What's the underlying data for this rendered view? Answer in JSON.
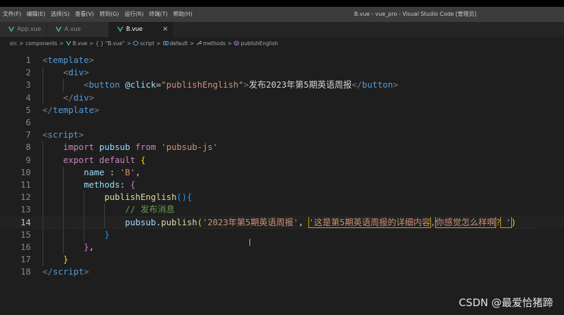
{
  "titlebar": {
    "menu": [
      "文件(F)",
      "编辑(E)",
      "选择(S)",
      "查看(V)",
      "转到(G)",
      "运行(R)",
      "终端(T)",
      "帮助(H)"
    ],
    "window_title": "B.vue - vue_pro - Visual Studio Code [管理员]"
  },
  "tabs": [
    {
      "label": "App.vue",
      "active": false
    },
    {
      "label": "A.vue",
      "active": false
    },
    {
      "label": "B.vue",
      "active": true,
      "close": "×"
    }
  ],
  "colors": {
    "vue_icon": "#42b883",
    "accent": "#007acc"
  },
  "breadcrumb": {
    "items": [
      {
        "label": "src",
        "icon": ""
      },
      {
        "label": "components",
        "icon": ""
      },
      {
        "label": "B.vue",
        "icon": "vue-icon"
      },
      {
        "label": "{ } \"B.vue\"",
        "icon": ""
      },
      {
        "label": "script",
        "icon": "script-icon"
      },
      {
        "label": "default",
        "icon": "variable-icon"
      },
      {
        "label": "methods",
        "icon": "wrench-icon"
      },
      {
        "label": "publishEnglish",
        "icon": "method-icon"
      }
    ],
    "separator": ">"
  },
  "editor": {
    "line_numbers": [
      "1",
      "2",
      "3",
      "4",
      "5",
      "6",
      "7",
      "8",
      "9",
      "10",
      "11",
      "12",
      "13",
      "14",
      "15",
      "16",
      "17",
      "18"
    ],
    "current_line": 14,
    "lines": [
      [
        [
          "t-punc",
          "<"
        ],
        [
          "t-tag",
          "template"
        ],
        [
          "t-punc",
          ">"
        ]
      ],
      [
        [
          "t-plain",
          "    "
        ],
        [
          "t-punc",
          "<"
        ],
        [
          "t-tag",
          "div"
        ],
        [
          "t-punc",
          ">"
        ]
      ],
      [
        [
          "t-plain",
          "        "
        ],
        [
          "t-punc",
          "<"
        ],
        [
          "t-tag",
          "button"
        ],
        [
          "t-plain",
          " "
        ],
        [
          "t-attr",
          "@click"
        ],
        [
          "t-plain",
          "="
        ],
        [
          "t-str",
          "\"publishEnglish\""
        ],
        [
          "t-punc",
          ">"
        ],
        [
          "t-text",
          "发布2023年第5期英语周报"
        ],
        [
          "t-punc",
          "</"
        ],
        [
          "t-tag",
          "button"
        ],
        [
          "t-punc",
          ">"
        ]
      ],
      [
        [
          "t-plain",
          "    "
        ],
        [
          "t-punc",
          "</"
        ],
        [
          "t-tag",
          "div"
        ],
        [
          "t-punc",
          ">"
        ]
      ],
      [
        [
          "t-punc",
          "</"
        ],
        [
          "t-tag",
          "template"
        ],
        [
          "t-punc",
          ">"
        ]
      ],
      [],
      [
        [
          "t-punc",
          "<"
        ],
        [
          "t-tag",
          "script"
        ],
        [
          "t-punc",
          ">"
        ]
      ],
      [
        [
          "t-plain",
          "    "
        ],
        [
          "t-kw",
          "import"
        ],
        [
          "t-plain",
          " "
        ],
        [
          "t-var",
          "pubsub"
        ],
        [
          "t-plain",
          " "
        ],
        [
          "t-kw",
          "from"
        ],
        [
          "t-plain",
          " "
        ],
        [
          "t-str",
          "'pubsub-js'"
        ]
      ],
      [
        [
          "t-plain",
          "    "
        ],
        [
          "t-kw",
          "export"
        ],
        [
          "t-plain",
          " "
        ],
        [
          "t-kw",
          "default"
        ],
        [
          "t-plain",
          " "
        ],
        [
          "t-br1",
          "{"
        ]
      ],
      [
        [
          "t-plain",
          "        "
        ],
        [
          "t-var",
          "name"
        ],
        [
          "t-plain",
          " : "
        ],
        [
          "t-str",
          "'B'"
        ],
        [
          "t-plain",
          ","
        ]
      ],
      [
        [
          "t-plain",
          "        "
        ],
        [
          "t-var",
          "methods"
        ],
        [
          "t-plain",
          ": "
        ],
        [
          "t-br2",
          "{"
        ]
      ],
      [
        [
          "t-plain",
          "            "
        ],
        [
          "t-fn",
          "publishEnglish"
        ],
        [
          "t-br3",
          "()"
        ],
        [
          "t-br3",
          "{"
        ]
      ],
      [
        [
          "t-plain",
          "                "
        ],
        [
          "t-cm",
          "// 发布消息"
        ]
      ],
      [
        [
          "t-plain",
          "                "
        ],
        [
          "t-var",
          "pubsub"
        ],
        [
          "t-plain",
          "."
        ],
        [
          "t-fn",
          "publish"
        ],
        [
          "t-br1",
          "("
        ],
        [
          "t-str",
          "'2023年第5期英语周报'"
        ],
        [
          "t-plain",
          ", "
        ],
        [
          "t-str",
          "'这是第5期英语周报的详细内容"
        ],
        [
          "t-str",
          ","
        ],
        [
          "t-str",
          "你感觉怎么样啊"
        ],
        [
          "t-str",
          "?"
        ],
        [
          "t-str",
          " '"
        ],
        [
          "t-br1",
          ")"
        ]
      ],
      [
        [
          "t-plain",
          "            "
        ],
        [
          "t-br3",
          "}"
        ]
      ],
      [
        [
          "t-plain",
          "        "
        ],
        [
          "t-br2",
          "}"
        ],
        [
          "t-plain",
          ","
        ]
      ],
      [
        [
          "t-plain",
          "    "
        ],
        [
          "t-br1",
          "}"
        ]
      ],
      [
        [
          "t-punc",
          "</"
        ],
        [
          "t-tag",
          "script"
        ],
        [
          "t-punc",
          ">"
        ]
      ]
    ]
  },
  "watermark": "CSDN @最爱恰猪蹄"
}
